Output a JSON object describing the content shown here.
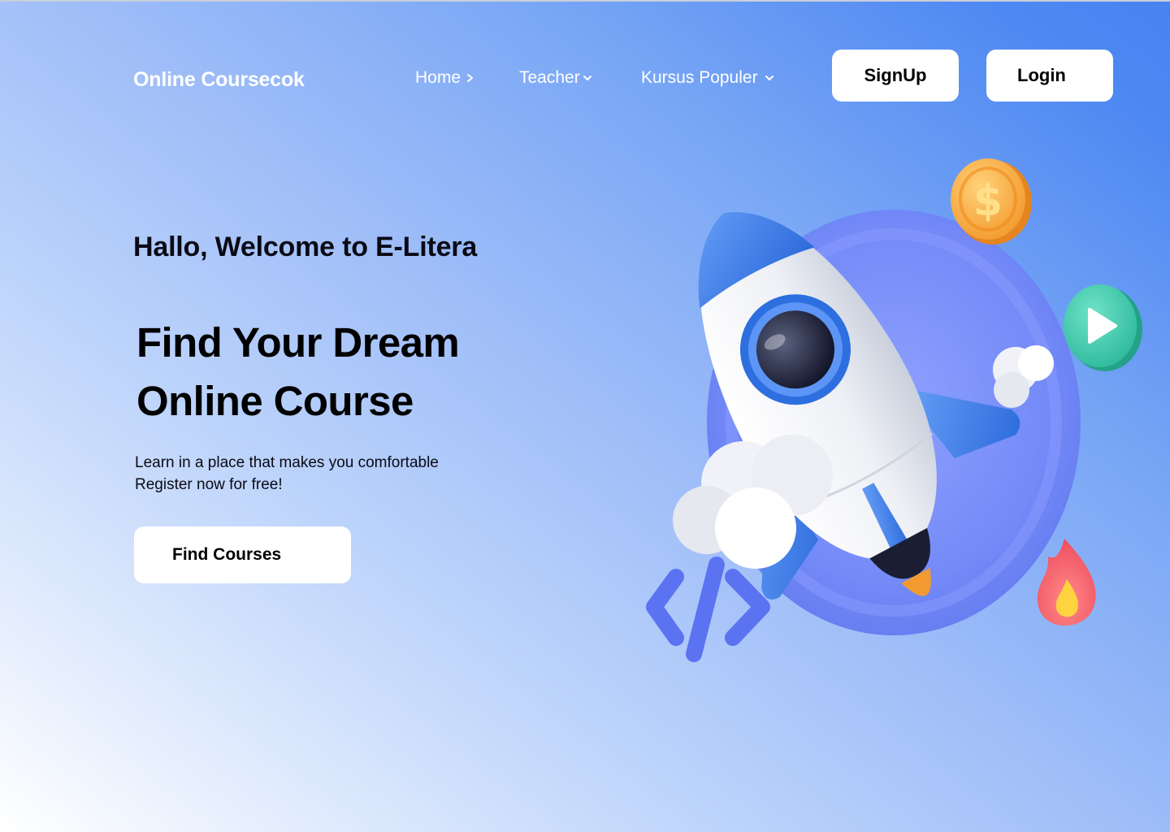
{
  "nav": {
    "brand": "Online Coursecok",
    "items": [
      {
        "label": "Home",
        "icon": "chevron-right-icon"
      },
      {
        "label": "Teacher",
        "icon": "chevron-down-icon"
      },
      {
        "label": "Kursus Populer",
        "icon": "chevron-down-icon"
      }
    ],
    "signup_label": "SignUp",
    "login_label": "Login"
  },
  "hero": {
    "welcome": "Hallo, Welcome to E-Litera",
    "headline_line1": "Find Your Dream",
    "headline_line2": "Online Course",
    "description_line1": "Learn in a place that makes you comfortable",
    "description_line2": "Register now for free!",
    "cta_label": "Find Courses"
  },
  "illustration": {
    "coin_symbol": "$",
    "icons": [
      "rocket-icon",
      "dollar-coin-icon",
      "play-icon",
      "code-icon",
      "fire-icon"
    ]
  },
  "colors": {
    "background_start": "#ffffff",
    "background_end": "#4784f1",
    "button_bg": "#ffffff",
    "rocket_blue": "#3b7be6",
    "coin": "#f6a93a",
    "play": "#35c7a9",
    "code": "#5b73f1",
    "fire": "#f25c6a"
  }
}
